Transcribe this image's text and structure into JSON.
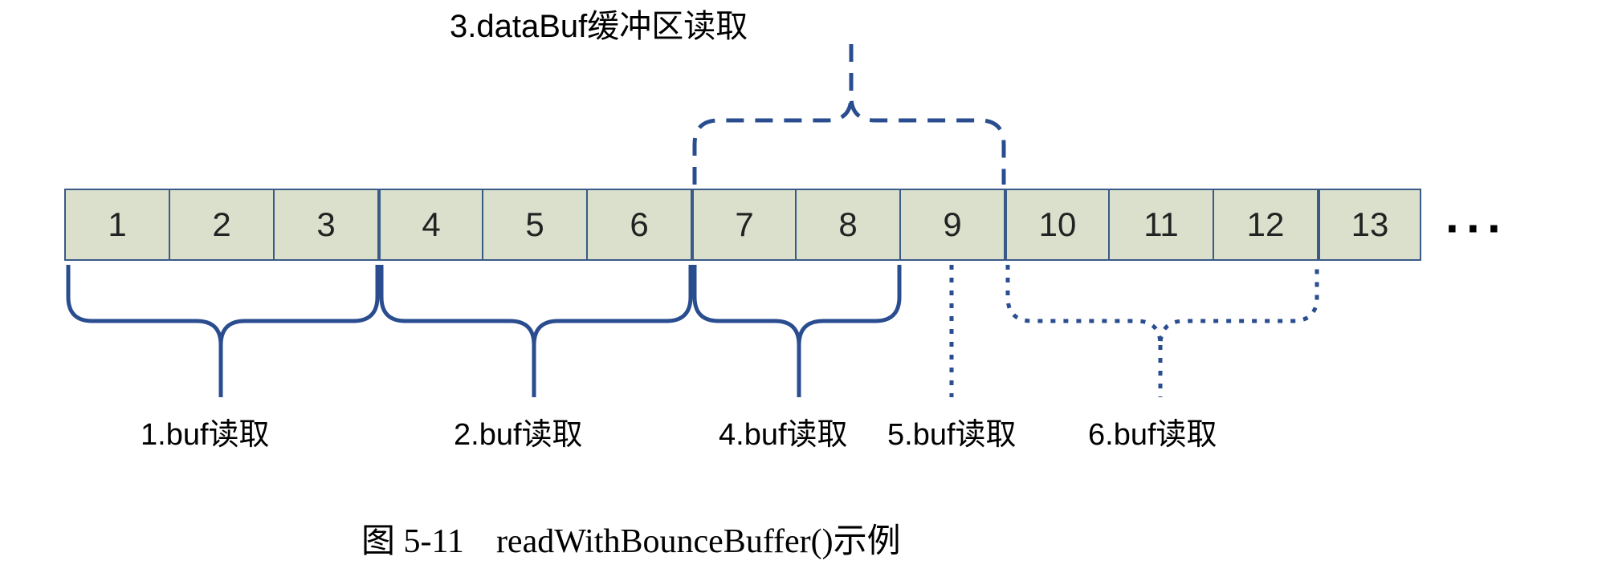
{
  "top_label": "3.dataBuf缓冲区读取",
  "cells": [
    "1",
    "2",
    "3",
    "4",
    "5",
    "6",
    "7",
    "8",
    "9",
    "10",
    "11",
    "12",
    "13"
  ],
  "ellipsis": "···",
  "labels": {
    "b1": "1.buf读取",
    "b2": "2.buf读取",
    "b4": "4.buf读取",
    "b5": "5.buf读取",
    "b6": "6.buf读取"
  },
  "caption_prefix": "图 5-11",
  "caption_text": "readWithBounceBuffer()示例",
  "chart_data": {
    "type": "table",
    "description": "Buffer read groupings over cells 1..13",
    "cells": [
      1,
      2,
      3,
      4,
      5,
      6,
      7,
      8,
      9,
      10,
      11,
      12,
      13
    ],
    "groups": [
      {
        "name": "1.buf读取",
        "cells": [
          1,
          2,
          3
        ],
        "style": "solid-brace-below"
      },
      {
        "name": "2.buf读取",
        "cells": [
          4,
          5,
          6
        ],
        "style": "solid-brace-below"
      },
      {
        "name": "3.dataBuf缓冲区读取",
        "cells": [
          7,
          8,
          9
        ],
        "style": "dashed-brace-above"
      },
      {
        "name": "4.buf读取",
        "cells": [
          7,
          8
        ],
        "style": "solid-brace-below"
      },
      {
        "name": "5.buf读取",
        "cells": [
          9
        ],
        "style": "dotted-line-below"
      },
      {
        "name": "6.buf读取",
        "cells": [
          10,
          11,
          12
        ],
        "style": "dotted-brace-below"
      }
    ],
    "title": "readWithBounceBuffer()示例"
  }
}
